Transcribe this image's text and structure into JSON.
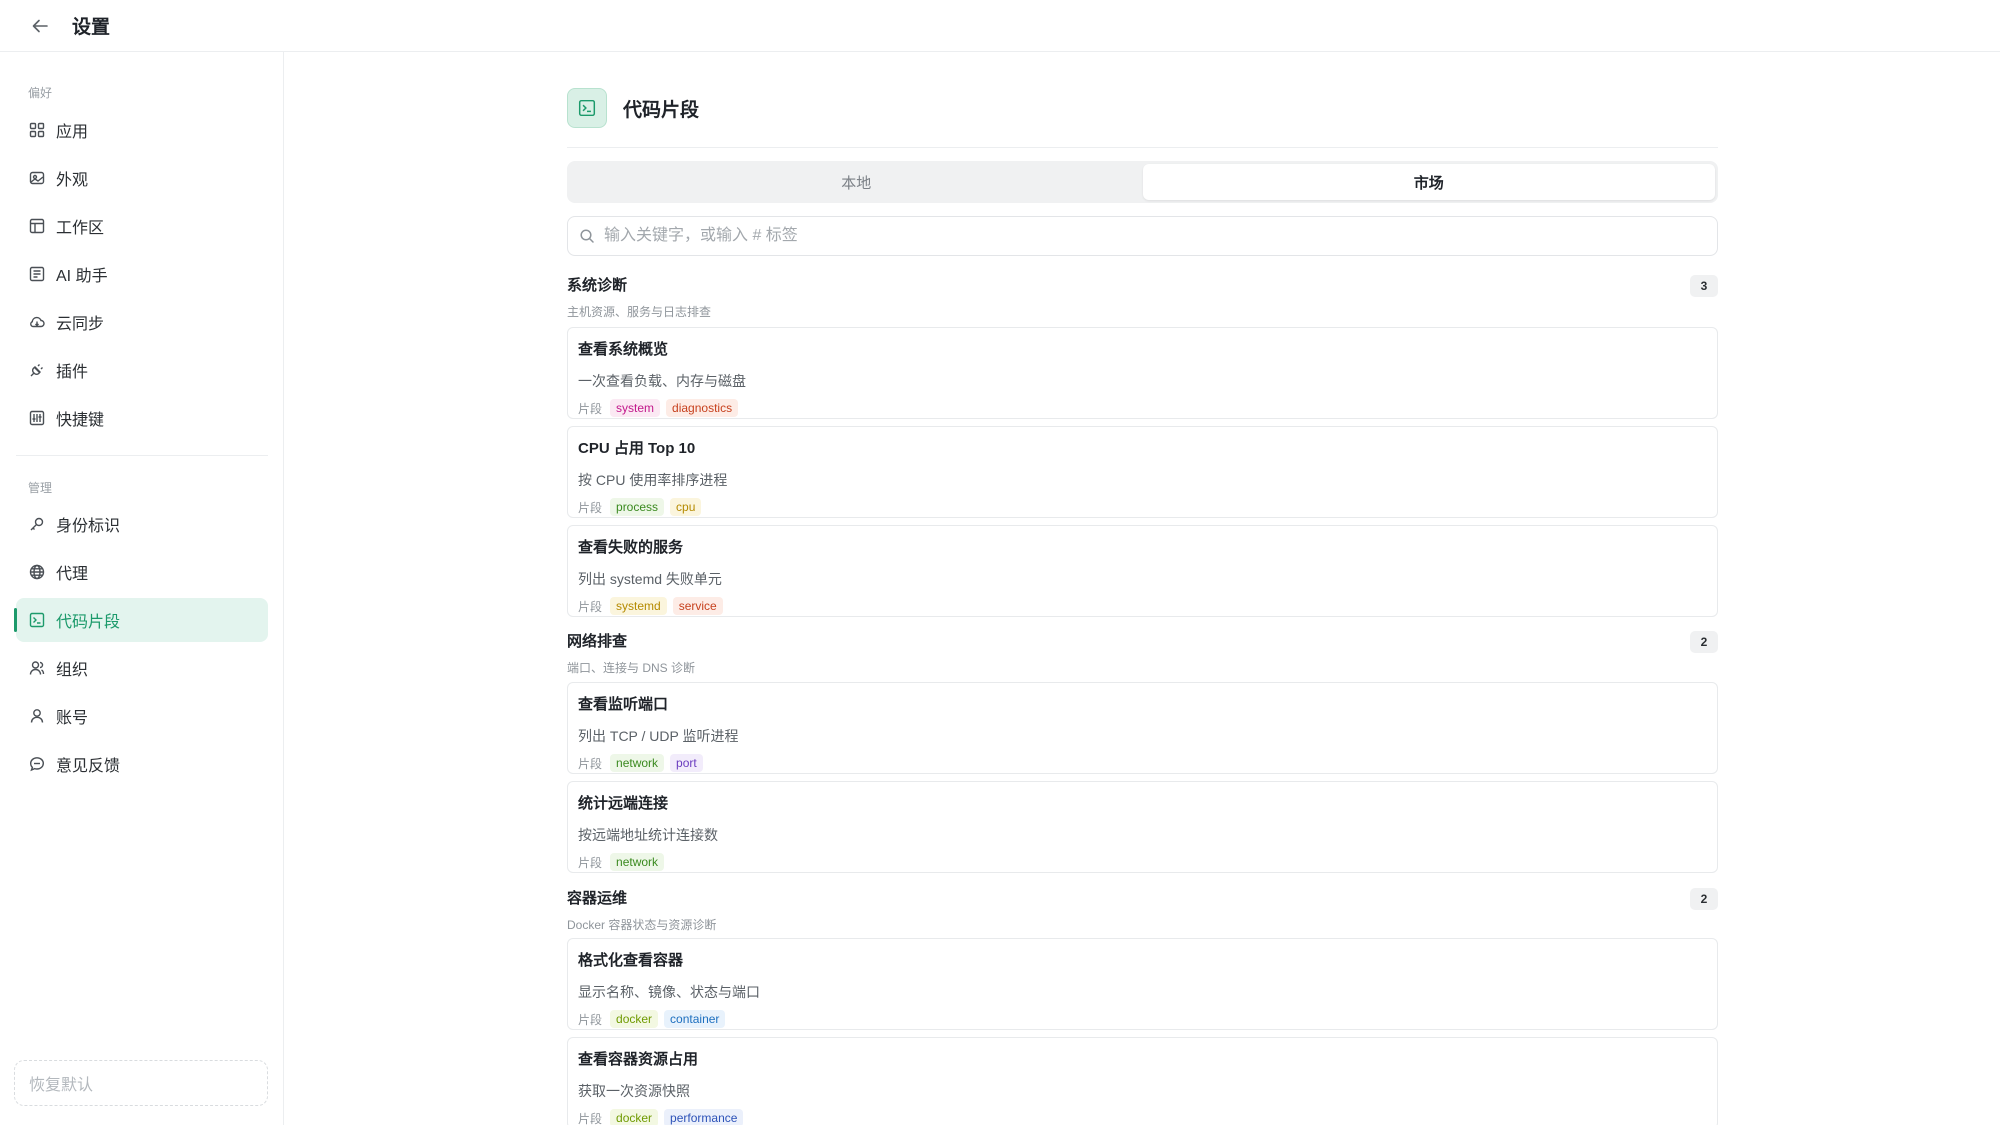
{
  "header": {
    "title": "设置"
  },
  "sidebar": {
    "sections": [
      {
        "label": "偏好",
        "items": [
          {
            "label": "应用",
            "icon": "grid-icon"
          },
          {
            "label": "外观",
            "icon": "palette-icon"
          },
          {
            "label": "工作区",
            "icon": "layout-icon"
          },
          {
            "label": "AI 助手",
            "icon": "ai-assistant-icon"
          },
          {
            "label": "云同步",
            "icon": "cloud-sync-icon"
          },
          {
            "label": "插件",
            "icon": "plug-icon"
          },
          {
            "label": "快捷键",
            "icon": "keyboard-icon"
          }
        ]
      },
      {
        "label": "管理",
        "items": [
          {
            "label": "身份标识",
            "icon": "key-icon"
          },
          {
            "label": "代理",
            "icon": "globe-icon"
          },
          {
            "label": "代码片段",
            "icon": "terminal-icon",
            "active": true
          },
          {
            "label": "组织",
            "icon": "users-icon"
          },
          {
            "label": "账号",
            "icon": "user-icon"
          },
          {
            "label": "意见反馈",
            "icon": "feedback-icon"
          }
        ]
      }
    ],
    "reset_label": "恢复默认"
  },
  "main": {
    "title": "代码片段",
    "tabs": [
      {
        "label": "本地",
        "active": false
      },
      {
        "label": "市场",
        "active": true
      }
    ],
    "search": {
      "placeholder": "输入关键字，或输入 # 标签",
      "value": ""
    },
    "kind_label": "片段",
    "groups": [
      {
        "title": "系统诊断",
        "subtitle": "主机资源、服务与日志排查",
        "count": "3",
        "items": [
          {
            "title": "查看系统概览",
            "desc": "一次查看负载、内存与磁盘",
            "tags": [
              {
                "text": "system",
                "color": "#c2188b",
                "bg": "#fbe9f3"
              },
              {
                "text": "diagnostics",
                "color": "#c7411e",
                "bg": "#fdece6"
              }
            ]
          },
          {
            "title": "CPU 占用 Top 10",
            "desc": "按 CPU 使用率排序进程",
            "tags": [
              {
                "text": "process",
                "color": "#3a8a1f",
                "bg": "#eef7e8"
              },
              {
                "text": "cpu",
                "color": "#b58a00",
                "bg": "#fbf5dd"
              }
            ]
          },
          {
            "title": "查看失败的服务",
            "desc": "列出 systemd 失败单元",
            "tags": [
              {
                "text": "systemd",
                "color": "#b58a00",
                "bg": "#fbf5dd"
              },
              {
                "text": "service",
                "color": "#c7411e",
                "bg": "#fdece6"
              }
            ]
          }
        ]
      },
      {
        "title": "网络排查",
        "subtitle": "端口、连接与 DNS 诊断",
        "count": "2",
        "items": [
          {
            "title": "查看监听端口",
            "desc": "列出 TCP / UDP 监听进程",
            "tags": [
              {
                "text": "network",
                "color": "#3a8a1f",
                "bg": "#eef7e8"
              },
              {
                "text": "port",
                "color": "#6a3bbf",
                "bg": "#f2ecfb"
              }
            ]
          },
          {
            "title": "统计远端连接",
            "desc": "按远端地址统计连接数",
            "tags": [
              {
                "text": "network",
                "color": "#3a8a1f",
                "bg": "#eef7e8"
              }
            ]
          }
        ]
      },
      {
        "title": "容器运维",
        "subtitle": "Docker 容器状态与资源诊断",
        "count": "2",
        "items": [
          {
            "title": "格式化查看容器",
            "desc": "显示名称、镜像、状态与端口",
            "tags": [
              {
                "text": "docker",
                "color": "#6f9a00",
                "bg": "#f3f8e2"
              },
              {
                "text": "container",
                "color": "#1d6fbf",
                "bg": "#e8f2fc"
              }
            ]
          },
          {
            "title": "查看容器资源占用",
            "desc": "获取一次资源快照",
            "tags": [
              {
                "text": "docker",
                "color": "#6f9a00",
                "bg": "#f3f8e2"
              },
              {
                "text": "performance",
                "color": "#2d52b8",
                "bg": "#ebf0fb"
              }
            ]
          }
        ]
      }
    ]
  },
  "colors": {
    "accent": "#1c9a6b",
    "accent_bg": "#e3f4ee"
  }
}
